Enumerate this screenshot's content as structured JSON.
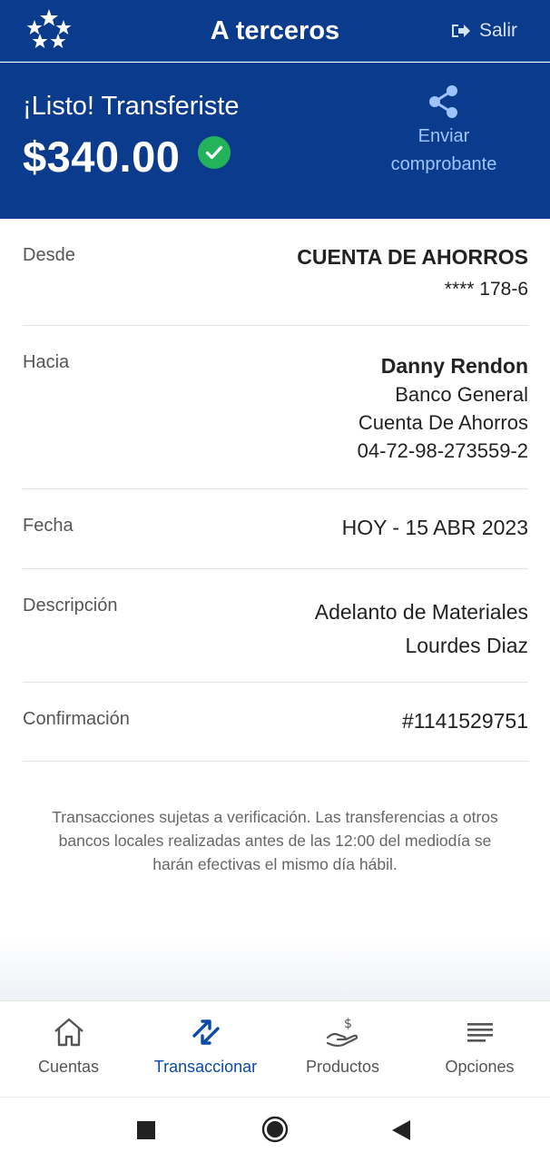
{
  "header": {
    "title": "A terceros",
    "logout_label": "Salir",
    "logo_icon": "stars-logo-icon",
    "logout_icon": "logout-icon"
  },
  "summary": {
    "message": "¡Listo! Transferiste",
    "amount": "$340.00",
    "status_icon": "check-circle-icon",
    "share_label_line1": "Enviar",
    "share_label_line2": "comprobante",
    "share_icon": "share-icon"
  },
  "details": {
    "from": {
      "label": "Desde",
      "account_type": "CUENTA DE AHORROS",
      "account_number": "**** 178-6"
    },
    "to": {
      "label": "Hacia",
      "name": "Danny Rendon",
      "bank": "Banco General",
      "account_type": "Cuenta De Ahorros",
      "account_number": "04-72-98-273559-2"
    },
    "date": {
      "label": "Fecha",
      "value": "HOY - 15 ABR 2023"
    },
    "description": {
      "label": "Descripción",
      "line1": "Adelanto de Materiales",
      "line2": "Lourdes Diaz"
    },
    "confirmation": {
      "label": "Confirmación",
      "value": "#1141529751"
    }
  },
  "disclaimer": "Transacciones sujetas a verificación. Las transferencias a otros bancos locales realizadas antes de las 12:00 del mediodía se harán efectivas el mismo día hábil.",
  "bottom_nav": [
    {
      "label": "Cuentas",
      "icon": "home-icon",
      "active": false
    },
    {
      "label": "Transaccionar",
      "icon": "transfer-arrows-icon",
      "active": true
    },
    {
      "label": "Productos",
      "icon": "hand-money-icon",
      "active": false
    },
    {
      "label": "Opciones",
      "icon": "menu-lines-icon",
      "active": false
    }
  ],
  "colors": {
    "brand_blue": "#0a3b8c",
    "accent_blue": "#0b4aa6",
    "success_green": "#24b35a",
    "link_blue": "#9fc3ff"
  }
}
